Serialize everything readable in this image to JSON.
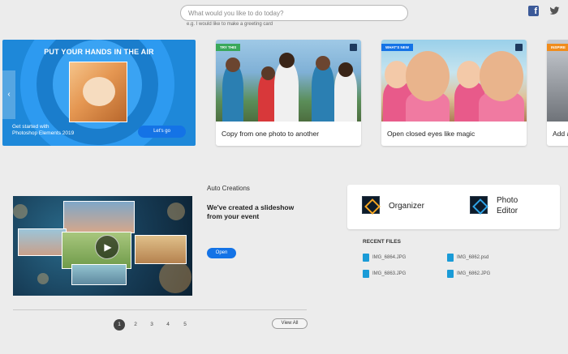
{
  "search": {
    "placeholder": "What would you like to do today?",
    "hint": "e.g. I would like to make a greeting card"
  },
  "social": {
    "facebook": "f"
  },
  "hero": {
    "title": "PUT YOUR HANDS IN THE AIR",
    "text_line1": "Get started with",
    "text_line2": "Photoshop Elements 2019",
    "button": "Let's go",
    "arrow": "‹"
  },
  "cards": [
    {
      "tag": "TRY THIS",
      "tag_color": "#3aa85a",
      "caption": "Copy from one photo to another"
    },
    {
      "tag": "WHAT'S NEW",
      "tag_color": "#1473e6",
      "caption": "Open closed eyes like magic"
    },
    {
      "tag": "INSPIRE",
      "tag_color": "#f08c1d",
      "caption": "Add a"
    }
  ],
  "auto": {
    "label": "Auto Creations",
    "title": "We've created a slideshow from your event",
    "open": "Open",
    "play": "▶"
  },
  "pagination": {
    "pages": [
      "1",
      "2",
      "3",
      "4",
      "5"
    ],
    "active": "1",
    "view_all": "View All"
  },
  "launchers": {
    "organizer": "Organizer",
    "editor_line1": "Photo",
    "editor_line2": "Editor"
  },
  "recent": {
    "heading": "RECENT FILES",
    "files": [
      "IMG_6864.JPG",
      "IMG_6862.psd",
      "IMG_6863.JPG",
      "IMG_6862.JPG"
    ]
  }
}
